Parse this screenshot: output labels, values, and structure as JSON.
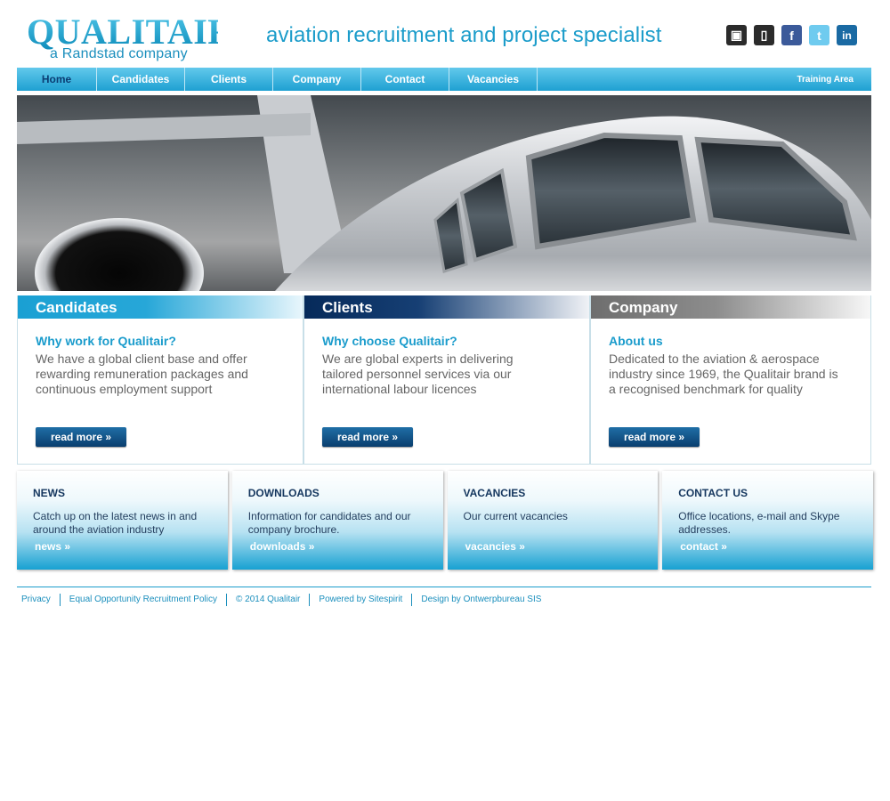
{
  "header": {
    "logo_main": "QUALITAIR",
    "logo_sub": "a Randstad company",
    "tagline": "aviation recruitment and project specialist",
    "social": [
      {
        "name": "android-icon",
        "glyph": "▣"
      },
      {
        "name": "mobile-icon",
        "glyph": "▯"
      },
      {
        "name": "facebook-icon",
        "glyph": "f"
      },
      {
        "name": "twitter-icon",
        "glyph": "t"
      },
      {
        "name": "linkedin-icon",
        "glyph": "in"
      }
    ]
  },
  "nav": {
    "items": [
      "Home",
      "Candidates",
      "Clients",
      "Company",
      "Contact",
      "Vacancies"
    ],
    "training": "Training Area"
  },
  "features": [
    {
      "title": "Candidates",
      "subtitle": "Why work for Qualitair?",
      "text": "We have a global client base and offer rewarding remuneration packages and continuous employment support",
      "button": "read more »"
    },
    {
      "title": "Clients",
      "subtitle": "Why choose Qualitair?",
      "text": "We are global experts in delivering tailored personnel services via our international labour licences",
      "button": "read more »"
    },
    {
      "title": "Company",
      "subtitle": "About us",
      "text": "Dedicated to the aviation & aerospace industry since 1969, the Qualitair brand is a recognised benchmark for quality",
      "button": "read more »"
    }
  ],
  "boxes": [
    {
      "title": "NEWS",
      "text": "Catch up on the latest news in and around the aviation industry",
      "link": "news »"
    },
    {
      "title": "DOWNLOADS",
      "text": "Information for candidates and our company brochure.",
      "link": "downloads »"
    },
    {
      "title": "VACANCIES",
      "text": "Our current vacancies",
      "link": "vacancies »"
    },
    {
      "title": "CONTACT US",
      "text": "Office locations, e-mail and Skype addresses.",
      "link": "contact »"
    }
  ],
  "footer": {
    "links": [
      "Privacy",
      "Equal Opportunity Recruitment Policy",
      "© 2014 Qualitair",
      "Powered by Sitespirit",
      "Design by Ontwerpbureau SIS"
    ]
  },
  "colors": {
    "accent": "#1b9ccc",
    "navy": "#0a3e6e",
    "grey": "#6e6e6e"
  }
}
